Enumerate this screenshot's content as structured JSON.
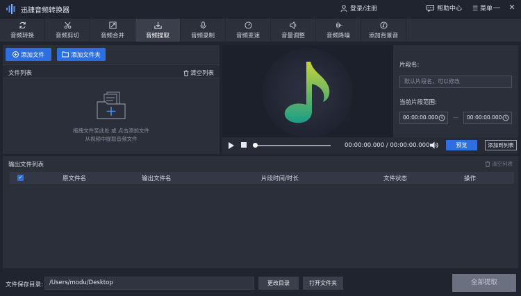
{
  "app": {
    "title": "迅捷音频转换器",
    "login": "登录/注册",
    "help": "帮助中心",
    "menu": "菜单",
    "colors": {
      "accent": "#2d6fe0",
      "note_top": "#b7cf3c",
      "note_bottom": "#1ea084"
    }
  },
  "tabs": [
    {
      "label": "音频转换",
      "icon": "refresh-icon"
    },
    {
      "label": "音频剪切",
      "icon": "scissors-icon"
    },
    {
      "label": "音频合并",
      "icon": "merge-icon"
    },
    {
      "label": "音频提取",
      "icon": "extract-icon",
      "active": true
    },
    {
      "label": "音频录制",
      "icon": "microphone-icon"
    },
    {
      "label": "音频变速",
      "icon": "speed-icon"
    },
    {
      "label": "音量调整",
      "icon": "volume-icon"
    },
    {
      "label": "音频降噪",
      "icon": "noise-icon"
    },
    {
      "label": "添加背景音",
      "icon": "music-icon"
    }
  ],
  "file_panel": {
    "add_file": "添加文件",
    "add_folder": "添加文件夹",
    "list_title": "文件列表",
    "clear_list": "清空列表",
    "hint_line1": "拖拽文件至此处 或 点击添加文件",
    "hint_line2": "从视频中提取音频文件"
  },
  "player": {
    "current_time": "00:00:00.000",
    "separator": "/",
    "total_time": "00:00:00.000",
    "preview": "预览",
    "add_to_list": "添加到列表",
    "progress": 0
  },
  "segment": {
    "name_label": "片段名:",
    "name_placeholder": "默认片段名，可以修改",
    "range_label": "当前片段范围:",
    "start": "00:00:00.000",
    "end": "00:00:00.000",
    "dash": "—"
  },
  "output": {
    "title": "输出文件列表",
    "clear": "清空列表",
    "columns": [
      "原文件名",
      "输出文件名",
      "片段时间/时长",
      "文件状态",
      "操作"
    ],
    "rows": []
  },
  "bottom": {
    "save_label": "文件保存目录:",
    "save_path": "/Users/modu/Desktop",
    "change_dir": "更改目录",
    "open_folder": "打开文件夹",
    "extract_all": "全部提取"
  }
}
